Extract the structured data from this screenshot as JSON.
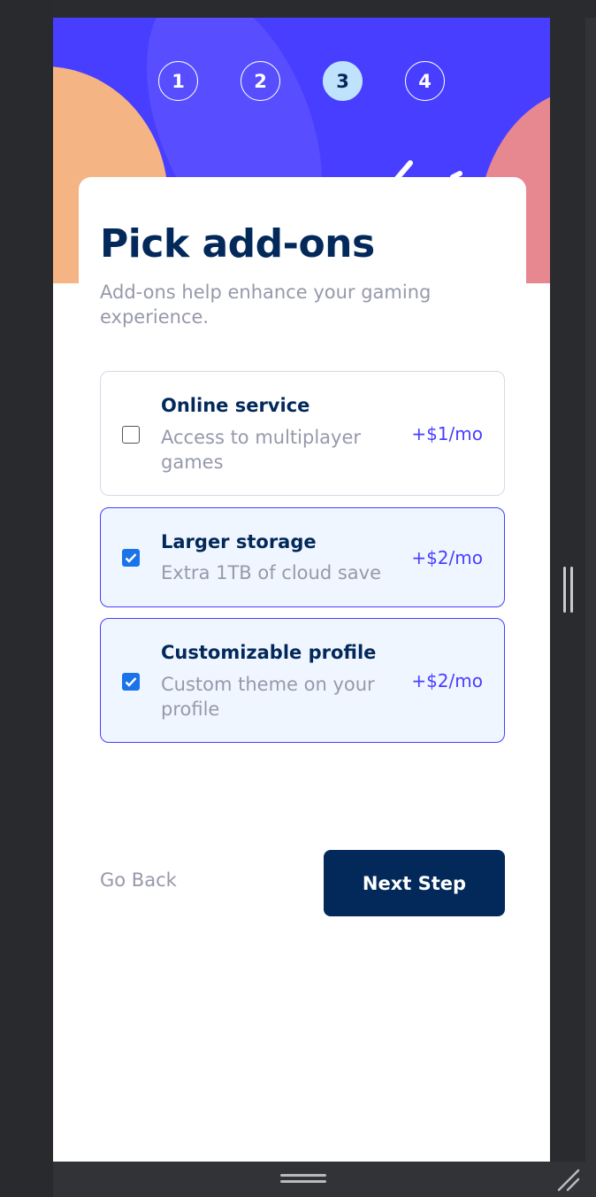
{
  "steps": [
    "1",
    "2",
    "3",
    "4"
  ],
  "active_step": 3,
  "header": {
    "title": "Pick add-ons",
    "subtitle": "Add-ons help enhance your gaming experience."
  },
  "addons": [
    {
      "name": "Online service",
      "description": "Access to multiplayer games",
      "price": "+$1/mo",
      "checked": false
    },
    {
      "name": "Larger storage",
      "description": "Extra 1TB of cloud save",
      "price": "+$2/mo",
      "checked": true
    },
    {
      "name": "Customizable profile",
      "description": "Custom theme on your profile",
      "price": "+$2/mo",
      "checked": true
    }
  ],
  "actions": {
    "back_label": "Go Back",
    "next_label": "Next Step"
  },
  "colors": {
    "header_bg": "#483eff",
    "accent": "#483eff",
    "primary_text": "#02295a",
    "muted_text": "#9699ab",
    "selected_bg": "#f0f6ff",
    "active_step_bg": "#bfe2fd",
    "checkbox_blue": "#1a73e8"
  }
}
